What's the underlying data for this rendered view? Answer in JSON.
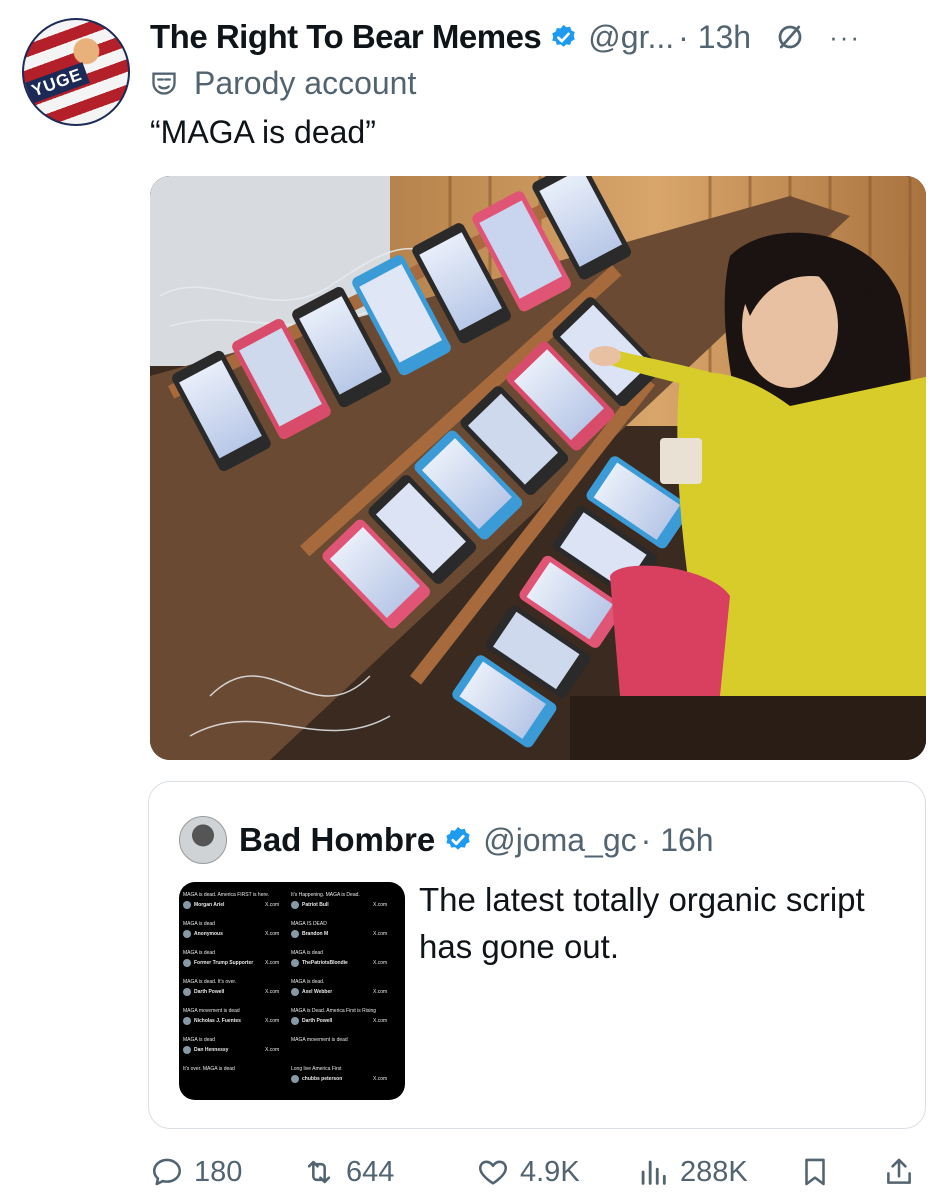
{
  "tweet": {
    "author_name": "The Right To Bear Memes",
    "handle": "@gr...",
    "time": "· 13h",
    "more": "···",
    "parody_label": "Parody account",
    "text": "“MAGA is dead”",
    "avatar_text": "YUGE"
  },
  "quoted": {
    "author_name": "Bad Hombre",
    "handle": "@joma_gc",
    "time": "· 16h",
    "text": "The latest totally organic script has gone out.",
    "thumbnail_posts": {
      "left": [
        {
          "text": "MAGA is dead. America FIRST is here.",
          "name": "Morgan Ariel"
        },
        {
          "text": "MAGA is dead",
          "name": "Anonymous"
        },
        {
          "text": "MAGA is dead",
          "name": "Former Trump Supporter"
        },
        {
          "text": "MAGA is dead. It's over.",
          "name": "Darth Powell"
        },
        {
          "text": "MAGA movement is dead",
          "name": "Nicholas J. Fuentes"
        },
        {
          "text": "MAGA is dead",
          "name": "Dan Hennessy"
        },
        {
          "text": "It's over. MAGA is dead",
          "name": ""
        }
      ],
      "right": [
        {
          "text": "It's Happening. MAGA is Dead.",
          "name": "Patriot Bull"
        },
        {
          "text": "MAGA IS DEAD",
          "name": "Brandon M"
        },
        {
          "text": "MAGA is dead",
          "name": "ThePatriotsBlondie"
        },
        {
          "text": "MAGA is dead.",
          "name": "Axel Webber"
        },
        {
          "text": "MAGA is Dead. America First is Rising",
          "name": "Darth Powell"
        },
        {
          "text": "MAGA movement is dead",
          "name": ""
        },
        {
          "text": "Long live America First",
          "name": "chubbs peterson"
        }
      ],
      "source": "X.com"
    }
  },
  "actions": {
    "replies": "180",
    "reposts": "644",
    "likes": "4.9K",
    "views": "288K"
  },
  "icons": [
    "verified-badge-icon",
    "mute-icon",
    "more-icon",
    "parody-mask-icon",
    "reply-icon",
    "repost-icon",
    "like-icon",
    "views-icon",
    "bookmark-icon",
    "share-icon"
  ],
  "colors": {
    "verified": "#1d9bf0",
    "secondary_text": "#536471",
    "text": "#0f1419"
  }
}
